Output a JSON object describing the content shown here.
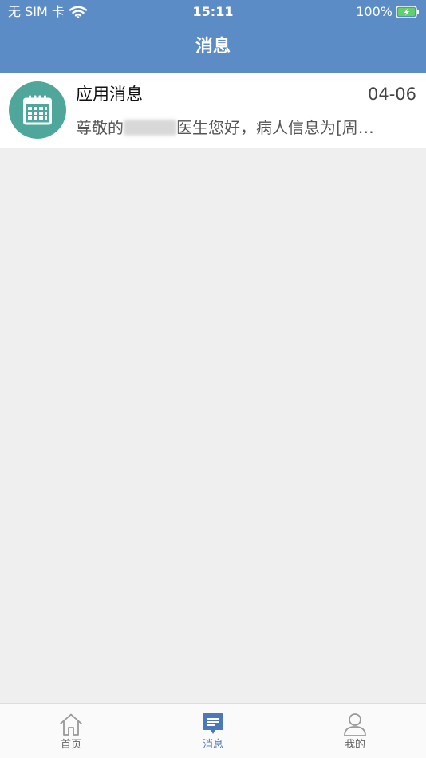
{
  "status_bar": {
    "carrier": "无 SIM 卡",
    "time": "15:11",
    "battery": "100%"
  },
  "header": {
    "title": "消息"
  },
  "messages": [
    {
      "icon": "calendar-icon",
      "title": "应用消息",
      "date": "04-06",
      "preview_prefix": "尊敬的",
      "preview_suffix": "医生您好，病人信息为[周…"
    }
  ],
  "tabbar": {
    "tabs": [
      {
        "label": "首页",
        "icon": "home-icon",
        "active": false
      },
      {
        "label": "消息",
        "icon": "message-icon",
        "active": true
      },
      {
        "label": "我的",
        "icon": "person-icon",
        "active": false
      }
    ]
  },
  "colors": {
    "header_bg": "#5b8cc6",
    "avatar_bg": "#4fa79b",
    "active_tab": "#4a78b8",
    "page_bg": "#efefef"
  }
}
